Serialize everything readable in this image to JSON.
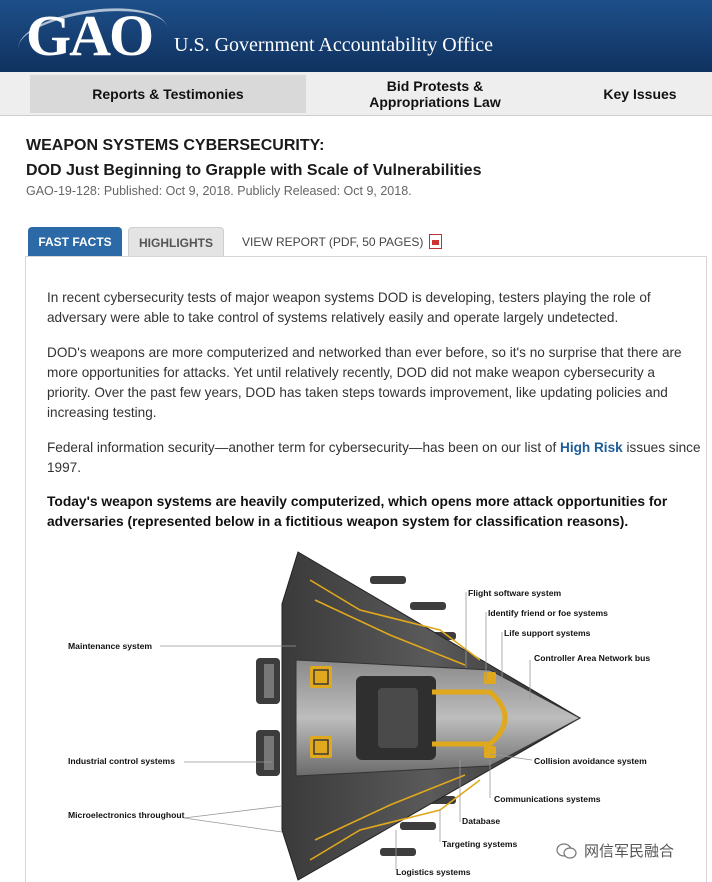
{
  "header": {
    "logo_text": "GAO",
    "org_name": "U.S. Government Accountability Office"
  },
  "nav": {
    "items": [
      {
        "label": "Reports & Testimonies"
      },
      {
        "label_line1": "Bid Protests &",
        "label_line2": "Appropriations Law"
      },
      {
        "label": "Key Issues"
      }
    ]
  },
  "report": {
    "title": "WEAPON SYSTEMS CYBERSECURITY:",
    "subtitle": "DOD Just Beginning to Grapple with Scale of Vulnerabilities",
    "pub_info": "GAO-19-128: Published: Oct 9, 2018. Publicly Released: Oct 9, 2018."
  },
  "tabs": {
    "fast_facts": "FAST FACTS",
    "highlights": "HIGHLIGHTS",
    "view_report": "VIEW REPORT (PDF, 50 PAGES)"
  },
  "content": {
    "p1": "In recent cybersecurity tests of major weapon systems DOD is developing, testers playing the role of adversary were able to take control of systems relatively easily and operate largely undetected.",
    "p2": "DOD's weapons are more computerized and networked than ever before, so it's no surprise that there are more opportunities for attacks. Yet until relatively recently, DOD did not make weapon cybersecurity a priority. Over the past few years, DOD has taken steps towards improvement, like updating policies and increasing testing.",
    "p3_before": "Federal information security—another term for cybersecurity—has been on our list of ",
    "p3_link": "High Risk",
    "p3_after": " issues since 1997.",
    "p4": "Today's weapon systems are heavily computerized, which opens more attack opportunities for adversaries (represented below in a fictitious weapon system for classification reasons)."
  },
  "diagram": {
    "labels": {
      "flight_software": "Flight software system",
      "iff": "Identify friend or foe systems",
      "life_support": "Life support systems",
      "can_bus": "Controller Area Network bus",
      "maintenance": "Maintenance system",
      "industrial_control": "Industrial control systems",
      "collision_avoidance": "Collision avoidance system",
      "communications": "Communications systems",
      "microelectronics": "Microelectronics throughout",
      "database": "Database",
      "targeting": "Targeting systems",
      "logistics": "Logistics systems"
    },
    "colors": {
      "body": "#4a4a4a",
      "accent": "#e0a81c"
    }
  },
  "watermark": {
    "text": "网信军民融合"
  },
  "colors": {
    "header_blue": "#163f72",
    "tab_active": "#2b6aa6",
    "link": "#1f5d99"
  }
}
